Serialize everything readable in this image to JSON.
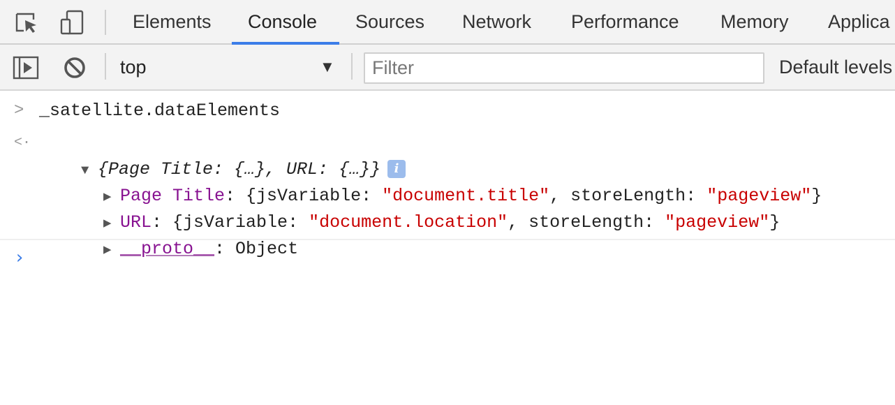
{
  "tabs": [
    {
      "label": "Elements",
      "active": false
    },
    {
      "label": "Console",
      "active": true
    },
    {
      "label": "Sources",
      "active": false
    },
    {
      "label": "Network",
      "active": false
    },
    {
      "label": "Performance",
      "active": false
    },
    {
      "label": "Memory",
      "active": false
    },
    {
      "label": "Applica",
      "active": false
    }
  ],
  "toolbar": {
    "context": "top",
    "filter_placeholder": "Filter",
    "levels_label": "Default levels"
  },
  "console": {
    "input_command": "_satellite.dataElements",
    "result_summary": "{Page Title: {…}, URL: {…}}",
    "entries": [
      {
        "key": "Page Title",
        "open": ": {jsVariable: ",
        "value1": "\"document.title\"",
        "mid": ", storeLength: ",
        "value2": "\"pageview\"",
        "close": "}"
      },
      {
        "key": "URL",
        "open": ": {jsVariable: ",
        "value1": "\"document.location\"",
        "mid": ", storeLength: ",
        "value2": "\"pageview\"",
        "close": "}"
      }
    ],
    "proto_key": "__proto__",
    "proto_value": ": Object"
  },
  "colors": {
    "accent": "#3b7de8",
    "property_key": "#881391",
    "string_value": "#c80000"
  },
  "icons": [
    "inspect-element-icon",
    "device-toolbar-icon",
    "show-sidebar-icon",
    "clear-console-icon",
    "dropdown-arrow-icon",
    "info-icon",
    "chevron-right-icon",
    "triangle-right-icon",
    "triangle-down-icon"
  ]
}
